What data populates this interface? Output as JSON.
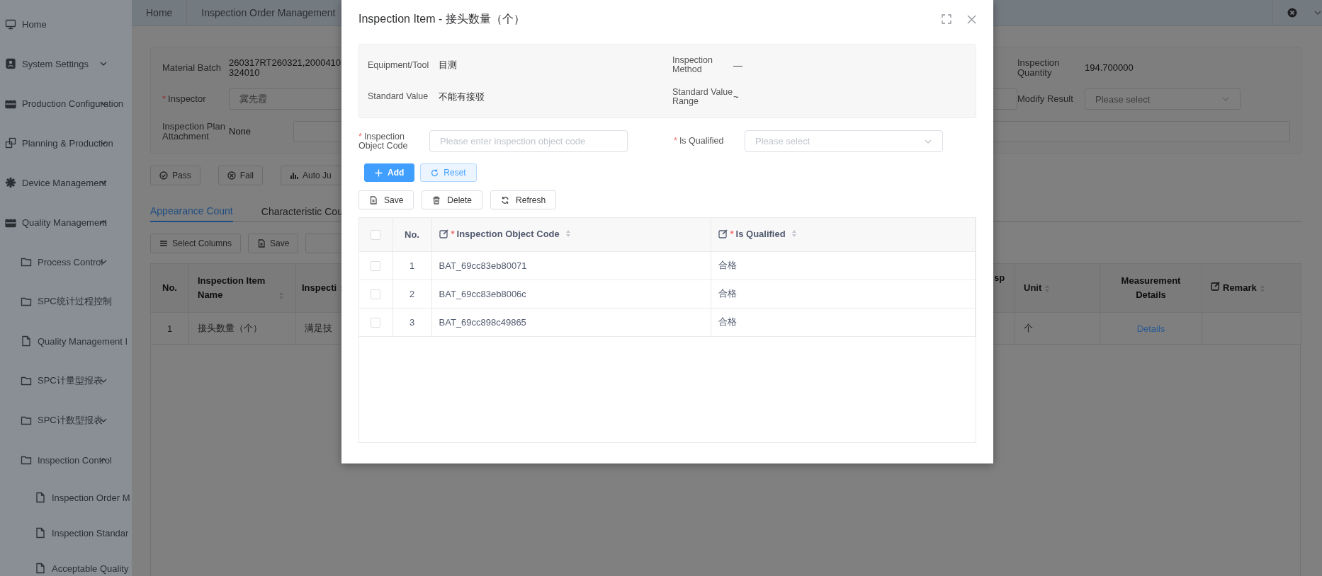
{
  "sidebar": {
    "items": [
      {
        "label": "Home",
        "kind": "page"
      },
      {
        "label": "System Settings",
        "kind": "group",
        "expanded": false
      },
      {
        "label": "Production Configuration",
        "kind": "group",
        "expanded": false
      },
      {
        "label": "Planning & Production",
        "kind": "group",
        "expanded": false
      },
      {
        "label": "Device Management",
        "kind": "group",
        "expanded": false
      },
      {
        "label": "Quality Management",
        "kind": "group",
        "expanded": true,
        "children": [
          {
            "label": "Process Control",
            "kind": "folder",
            "expanded": false
          },
          {
            "label": "SPC统计过程控制",
            "kind": "folder"
          },
          {
            "label": "Quality Management I",
            "kind": "page"
          },
          {
            "label": "SPC计量型报表",
            "kind": "folder",
            "expanded": false
          },
          {
            "label": "SPC计数型报表",
            "kind": "folder",
            "expanded": false
          },
          {
            "label": "Inspection Control",
            "kind": "folder",
            "expanded": true,
            "children": [
              {
                "label": "Inspection Order M",
                "kind": "page"
              },
              {
                "label": "Inspection Standar",
                "kind": "page"
              },
              {
                "label": "Acceptable Quality",
                "kind": "page"
              }
            ]
          }
        ]
      }
    ]
  },
  "tabs": [
    "Home",
    "Inspection Order Management"
  ],
  "form": {
    "material_batch": {
      "label": "Material Batch",
      "value": "260317RT260321,2000410\n324010"
    },
    "inspector": {
      "mark": "*",
      "label": "Inspector",
      "value": "冀先霞"
    },
    "attachment": {
      "label": "Inspection Plan Attachment",
      "value": "None"
    },
    "inspection_quantity": {
      "label": "Inspection Quantity",
      "value": "194.700000"
    },
    "modify_result": {
      "label": "Modify Result",
      "placeholder": "Please select"
    }
  },
  "actions": [
    "Pass",
    "Fail",
    "Auto Ju"
  ],
  "result_tabs": [
    {
      "label": "Appearance Count",
      "selected": true
    },
    {
      "label": "Characteristic Cou",
      "selected": false
    }
  ],
  "table_tools": [
    "Select Columns",
    "Save"
  ],
  "table": {
    "columns": [
      "No.",
      "Inspection Item Name",
      "Inspecti",
      "sp",
      "Unit",
      "Measurement Details",
      "Remark"
    ],
    "rows": [
      [
        "1",
        "接头数量（个）",
        "满足技",
        "",
        "个",
        "Details",
        ""
      ]
    ]
  },
  "dialog": {
    "title": "Inspection Item - 接头数量（个）",
    "info": [
      {
        "label": "Equipment/Tool",
        "value": "目测"
      },
      {
        "label": "Inspection Method",
        "value": "—"
      },
      {
        "label": "Standard Value",
        "value": "不能有接驳"
      },
      {
        "label": "Standard Value Range",
        "value": "~"
      }
    ],
    "object_code": {
      "mark": "*",
      "label": "Inspection Object Code",
      "placeholder": "Please enter inspection object code"
    },
    "is_qualified": {
      "mark": "*",
      "label": "Is Qualified",
      "placeholder": "Please select"
    },
    "add_button": "Add",
    "reset_button": "Reset",
    "toolbar": [
      "Save",
      "Delete",
      "Refresh"
    ],
    "table": {
      "header_checked": false,
      "columns": [
        {
          "label": "No."
        },
        {
          "mark": "*",
          "label": "Inspection Object Code"
        },
        {
          "mark": "*",
          "label": "Is Qualified"
        }
      ],
      "rows": [
        {
          "selected": false,
          "no": "1",
          "code": "BAT_69cc83eb80071",
          "qualified": "合格"
        },
        {
          "selected": false,
          "no": "2",
          "code": "BAT_69cc83eb8006c",
          "qualified": "合格"
        },
        {
          "selected": false,
          "no": "3",
          "code": "BAT_69cc898c49865",
          "qualified": "合格"
        }
      ]
    }
  }
}
